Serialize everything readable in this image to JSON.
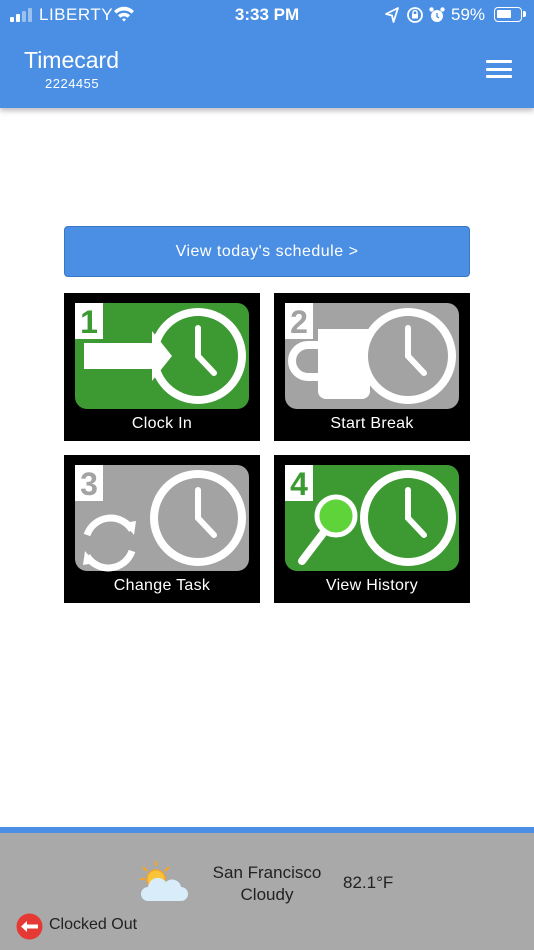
{
  "status_bar": {
    "carrier": "LIBERTY",
    "time": "3:33 PM",
    "battery_pct": "59%"
  },
  "header": {
    "title": "Timecard",
    "subtitle": "2224455",
    "menu_icon": "hamburger-icon"
  },
  "schedule_button": {
    "label": "View today's schedule >"
  },
  "tiles": [
    {
      "number": "1",
      "label": "Clock In",
      "icon": "clock-in-icon",
      "color": "#3d9a32"
    },
    {
      "number": "2",
      "label": "Start Break",
      "icon": "coffee-cup-clock-icon",
      "color": "#a3a3a3"
    },
    {
      "number": "3",
      "label": "Change Task",
      "icon": "change-task-clock-icon",
      "color": "#a3a3a3"
    },
    {
      "number": "4",
      "label": "View History",
      "icon": "history-magnifier-clock-icon",
      "color": "#3d9a32"
    }
  ],
  "footer": {
    "city": "San Francisco",
    "condition": "Cloudy",
    "temperature": "82.1°F",
    "weather_icon": "partly-cloudy-icon",
    "clock_status": "Clocked Out",
    "clock_status_icon": "clocked-out-arrow-icon"
  },
  "colors": {
    "primary": "#4a8fe3",
    "tile_active": "#3d9a32",
    "tile_inactive": "#a3a3a3",
    "footer_bg": "#a9a9a9",
    "status_red": "#e53935"
  }
}
